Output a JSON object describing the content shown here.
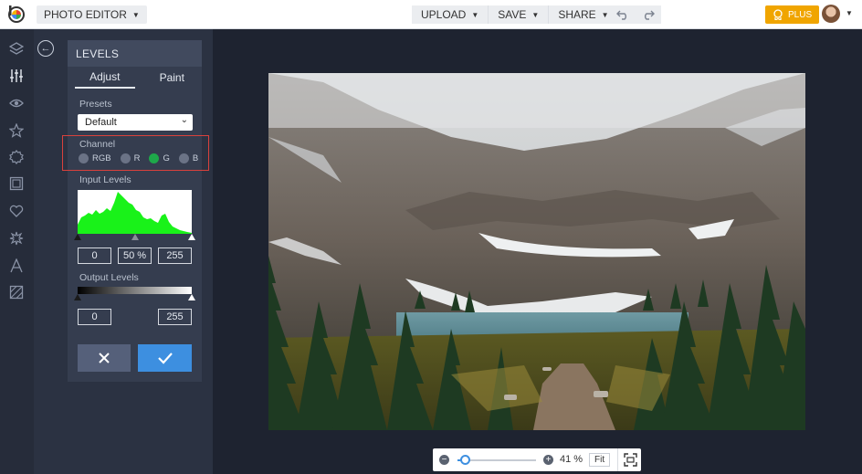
{
  "topbar": {
    "app_menu_label": "PHOTO EDITOR",
    "upload_label": "UPLOAD",
    "save_label": "SAVE",
    "share_label": "SHARE",
    "plus_label": "PLUS"
  },
  "rail": {
    "icons": [
      "layers-icon",
      "sliders-icon",
      "eye-icon",
      "star-icon",
      "gear-badge-icon",
      "frame-icon",
      "heart-icon",
      "sparkle-icon",
      "text-icon",
      "texture-icon"
    ]
  },
  "panel": {
    "title": "LEVELS",
    "tabs": [
      {
        "label": "Adjust",
        "active": true
      },
      {
        "label": "Paint",
        "active": false
      }
    ],
    "presets_label": "Presets",
    "preset_value": "Default",
    "channel_label": "Channel",
    "channels": [
      {
        "label": "RGB",
        "selected": false
      },
      {
        "label": "R",
        "selected": false
      },
      {
        "label": "G",
        "selected": true
      },
      {
        "label": "B",
        "selected": false
      }
    ],
    "input_levels_label": "Input Levels",
    "input_black": "0",
    "input_mid": "50 %",
    "input_white": "255",
    "output_levels_label": "Output Levels",
    "output_black": "0",
    "output_white": "255"
  },
  "colors": {
    "accent_blue": "#3d8fe0",
    "plus_orange": "#f0a500",
    "channel_green": "#1ea84a",
    "highlight_red": "#d9413c",
    "histogram_green": "#19f219"
  },
  "zoom": {
    "percent_label": "41 %",
    "fit_label": "Fit",
    "level": 0.41
  }
}
